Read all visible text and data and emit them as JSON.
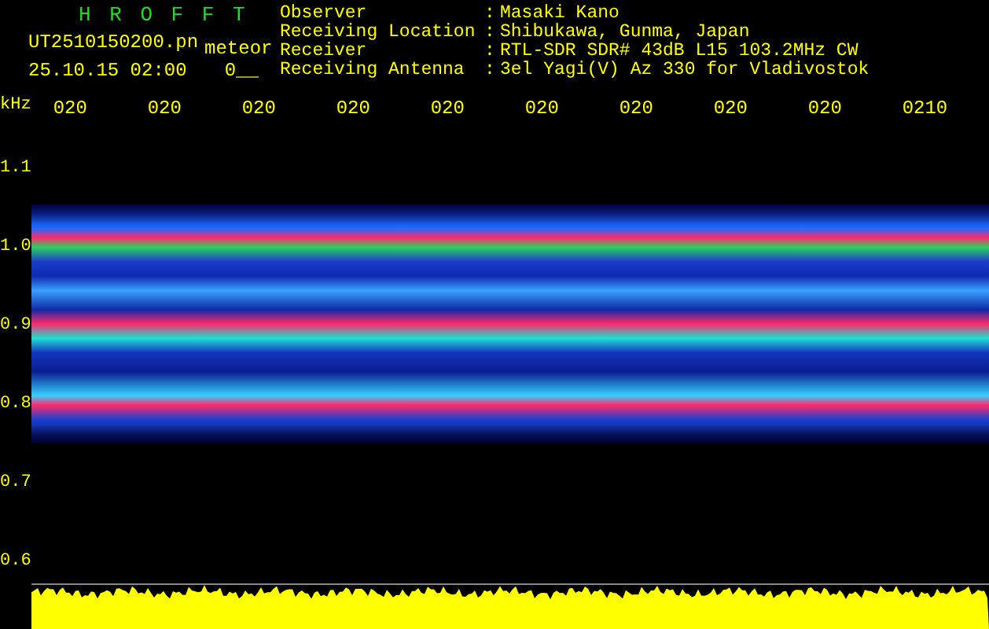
{
  "app_title": "H R O F F T",
  "file": {
    "name": "UT2510150200.pn",
    "tag": "meteor",
    "datetime": "25.10.15 02:00",
    "count": "0__"
  },
  "info": [
    {
      "label": "Observer",
      "separator": ":",
      "value": "Masaki Kano"
    },
    {
      "label": "Receiving Location",
      "separator": ":",
      "value": "Shibukawa, Gunma, Japan"
    },
    {
      "label": "Receiver",
      "separator": ":",
      "value": "RTL-SDR SDR# 43dB L15 103.2MHz CW"
    },
    {
      "label": "Receiving Antenna",
      "separator": ":",
      "value": "3el Yagi(V) Az 330 for Vladivostok"
    }
  ],
  "freq_axis": {
    "unit": "kHz",
    "ticks": [
      "1.1",
      "1.0",
      "0.9",
      "0.8",
      "0.7",
      "0.6"
    ]
  },
  "time_axis": {
    "ticks": [
      "020",
      "020",
      "020",
      "020",
      "020",
      "020",
      "020",
      "020",
      "020",
      "0210"
    ]
  }
}
